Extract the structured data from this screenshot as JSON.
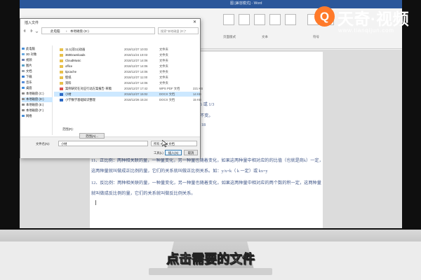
{
  "word": {
    "title": "图 [兼容模式] - Word"
  },
  "ribbon": {
    "groups": [
      "页面版式",
      "文本",
      "符号"
    ]
  },
  "document": {
    "lines": [
      "6 或 1/3",
      "不变。",
      ":18",
      "11、正比例：两种相关联的量，一种量变化，另一种量也随着变化，如果这两种量中相对应的的比值（也就是商k）一定，",
      "这两种量就叫做成正比例的量，它们的关系就叫做正比例关系。如：y/x=k（ k 一定）或 kx=y",
      "12、反比例：两种相关联的量，一种量变化，另一种量也随着变化，如果这两种量中相对应的两个数的积一定，这两种量",
      "就叫做成反比例的量，它们的关系就叫做反比例关系。"
    ]
  },
  "dialog": {
    "title": "插入文件",
    "close_glyph": "✕",
    "address": {
      "crumbs": [
        "此电脑",
        "本地磁盘 (D:)"
      ]
    },
    "search_placeholder": "搜索\"本地磁盘 (D:)\"",
    "nav_items": [
      {
        "label": "此电脑",
        "icon": "computer-icon",
        "selected": false
      },
      {
        "label": "3D 对象",
        "icon": "cube-icon",
        "selected": false
      },
      {
        "label": "视频",
        "icon": "video-icon",
        "selected": false
      },
      {
        "label": "图片",
        "icon": "picture-icon",
        "selected": false
      },
      {
        "label": "文档",
        "icon": "document-icon",
        "selected": false
      },
      {
        "label": "下载",
        "icon": "download-icon",
        "selected": false
      },
      {
        "label": "音乐",
        "icon": "music-icon",
        "selected": false
      },
      {
        "label": "桌面",
        "icon": "desktop-icon",
        "selected": false
      },
      {
        "label": "本地磁盘 (C:)",
        "icon": "drive-icon",
        "selected": false
      },
      {
        "label": "本地磁盘 (D:)",
        "icon": "drive-icon",
        "selected": true
      },
      {
        "label": "本地磁盘 (E:)",
        "icon": "drive-icon",
        "selected": false
      },
      {
        "label": "本地磁盘 (F:)",
        "icon": "drive-icon",
        "selected": false
      },
      {
        "label": "网络",
        "icon": "network-icon",
        "selected": false
      }
    ],
    "files": [
      {
        "name": "11.1(双11)动画",
        "date": "2018/12/27 10:03",
        "type": "文件夹",
        "size": "",
        "kind": "folder",
        "selected": false
      },
      {
        "name": "360Downloads",
        "date": "2018/11/24 10:03",
        "type": "文件夹",
        "size": "",
        "kind": "folder",
        "selected": false
      },
      {
        "name": "CloudMusic",
        "date": "2018/12/27 14:06",
        "type": "文件夹",
        "size": "",
        "kind": "folder",
        "selected": false
      },
      {
        "name": "office",
        "date": "2018/12/27 14:06",
        "type": "文件夹",
        "size": "",
        "kind": "folder",
        "selected": false
      },
      {
        "name": "tipcache",
        "date": "2018/12/27 14:06",
        "type": "文件夹",
        "size": "",
        "kind": "folder",
        "selected": false
      },
      {
        "name": "壁纸",
        "date": "2018/12/27 11:00",
        "type": "文件夹",
        "size": "",
        "kind": "folder",
        "selected": false
      },
      {
        "name": "资料",
        "date": "2018/12/27 14:06",
        "type": "文件夹",
        "size": "",
        "kind": "folder",
        "selected": false
      },
      {
        "name": "案例研究在对应行动方案报告-草稿",
        "date": "2018/12/27 17:42",
        "type": "WPS PDF 文档",
        "size": "221 KB",
        "kind": "pdf",
        "selected": false
      },
      {
        "name": "小材",
        "date": "2018/12/27 15:02",
        "type": "DOCX 文档",
        "size": "14 KB",
        "kind": "docx",
        "selected": true
      },
      {
        "name": "小学数学基础知识整理",
        "date": "2018/12/26 15:24",
        "type": "DOCX 文档",
        "size": "15 KB",
        "kind": "docx",
        "selected": false
      }
    ],
    "range_label": "范围(R):",
    "range_button": "范围(A)...",
    "filename_label": "文件名(N):",
    "filename_value": "小材",
    "filetype_value": "所有 Word 文档",
    "tools_label": "工具(L)",
    "insert_label": "插入(S)",
    "cancel_label": "取消"
  },
  "branding": {
    "logo_glyph": "Q",
    "name": "天奇·视频",
    "url": "www.tianqijun.com"
  },
  "subtitle": "点击需要的文件",
  "colors": {
    "word_blue": "#2b579a",
    "selection": "#cce8ff",
    "logo_orange": "#ff7a2a"
  }
}
